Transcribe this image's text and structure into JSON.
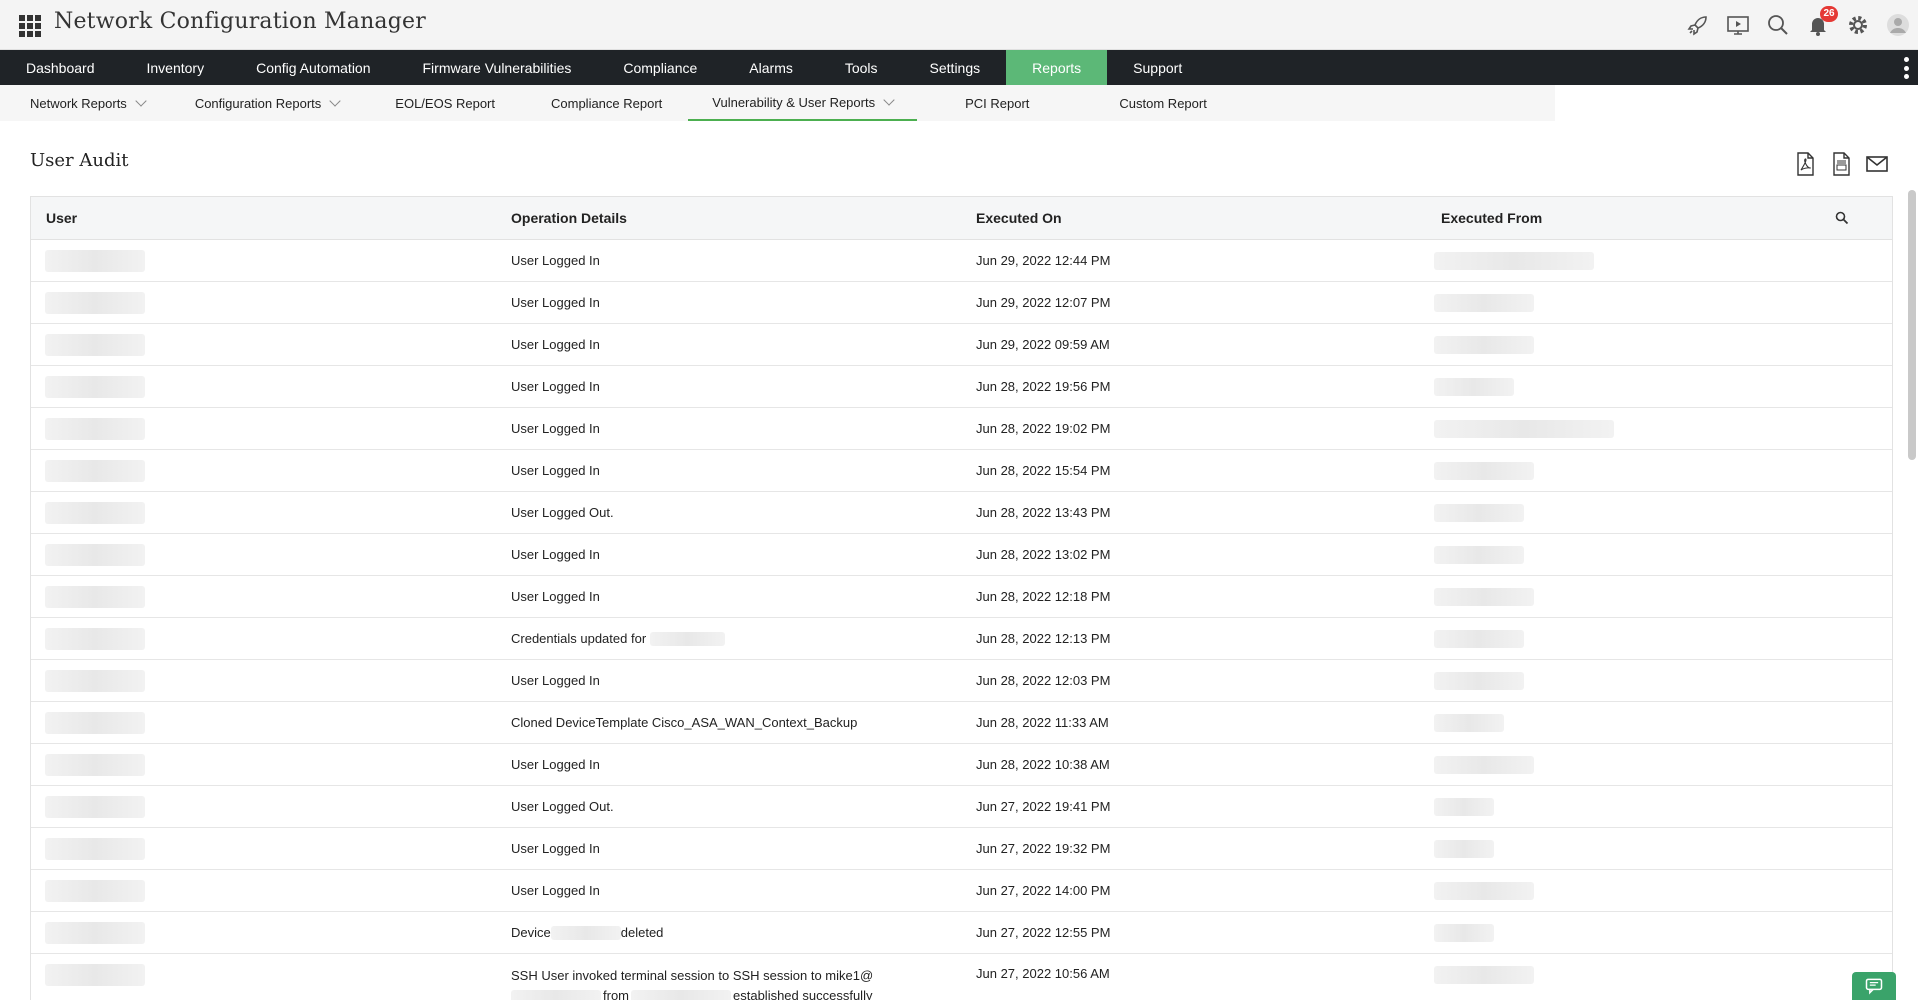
{
  "header": {
    "title": "Network Configuration Manager",
    "notification_count": "26",
    "icons": [
      "rocket-icon",
      "presentation-icon",
      "search-icon",
      "bell-icon",
      "gear-icon",
      "user-avatar-icon"
    ]
  },
  "main_nav": {
    "items": [
      {
        "label": "Dashboard"
      },
      {
        "label": "Inventory"
      },
      {
        "label": "Config Automation"
      },
      {
        "label": "Firmware Vulnerabilities"
      },
      {
        "label": "Compliance"
      },
      {
        "label": "Alarms"
      },
      {
        "label": "Tools"
      },
      {
        "label": "Settings"
      },
      {
        "label": "Reports"
      },
      {
        "label": "Support"
      }
    ],
    "active": "Reports",
    "active_color": "#5cb877"
  },
  "sub_nav": {
    "items": [
      {
        "label": "Network Reports"
      },
      {
        "label": "Configuration Reports"
      },
      {
        "label": "EOL/EOS Report"
      },
      {
        "label": "Compliance Report"
      },
      {
        "label": "Vulnerability & User Reports"
      },
      {
        "label": "PCI Report"
      },
      {
        "label": "Custom Report"
      }
    ],
    "active": "Vulnerability & User Reports"
  },
  "page": {
    "title": "User Audit",
    "export_icons": [
      "pdf-icon",
      "csv-icon",
      "email-icon"
    ]
  },
  "table": {
    "headers": {
      "user": "User",
      "operation": "Operation Details",
      "executed_on": "Executed On",
      "executed_from": "Executed From"
    },
    "rows": [
      {
        "op": "User Logged In",
        "date": "Jun 29, 2022 12:44 PM"
      },
      {
        "op": "User Logged In",
        "date": "Jun 29, 2022 12:07 PM"
      },
      {
        "op": "User Logged In",
        "date": "Jun 29, 2022 09:59 AM"
      },
      {
        "op": "User Logged In",
        "date": "Jun 28, 2022 19:56 PM"
      },
      {
        "op": "User Logged In",
        "date": "Jun 28, 2022 19:02 PM"
      },
      {
        "op": "User Logged In",
        "date": "Jun 28, 2022 15:54 PM"
      },
      {
        "op": "User Logged Out.",
        "date": "Jun 28, 2022 13:43 PM"
      },
      {
        "op": "User Logged In",
        "date": "Jun 28, 2022 13:02 PM"
      },
      {
        "op": "User Logged In",
        "date": "Jun 28, 2022 12:18 PM"
      },
      {
        "op": "Credentials updated for",
        "date": "Jun 28, 2022 12:13 PM"
      },
      {
        "op": "User Logged In",
        "date": "Jun 28, 2022 12:03 PM"
      },
      {
        "op": "Cloned DeviceTemplate Cisco_ASA_WAN_Context_Backup",
        "date": "Jun 28, 2022 11:33 AM"
      },
      {
        "op": "User Logged In",
        "date": "Jun 28, 2022 10:38 AM"
      },
      {
        "op": "User Logged Out.",
        "date": "Jun 27, 2022 19:41 PM"
      },
      {
        "op": "User Logged In",
        "date": "Jun 27, 2022 19:32 PM"
      },
      {
        "op": "User Logged In",
        "date": "Jun 27, 2022 14:00 PM"
      },
      {
        "op_prefix": "Device",
        "op_suffix": "deleted",
        "date": "Jun 27, 2022 12:55 PM"
      },
      {
        "op_line1": "SSH User invoked terminal session to SSH session to mike1@",
        "op_from": "from",
        "op_end": "established successfully",
        "date": "Jun 27, 2022 10:56 AM"
      }
    ]
  }
}
